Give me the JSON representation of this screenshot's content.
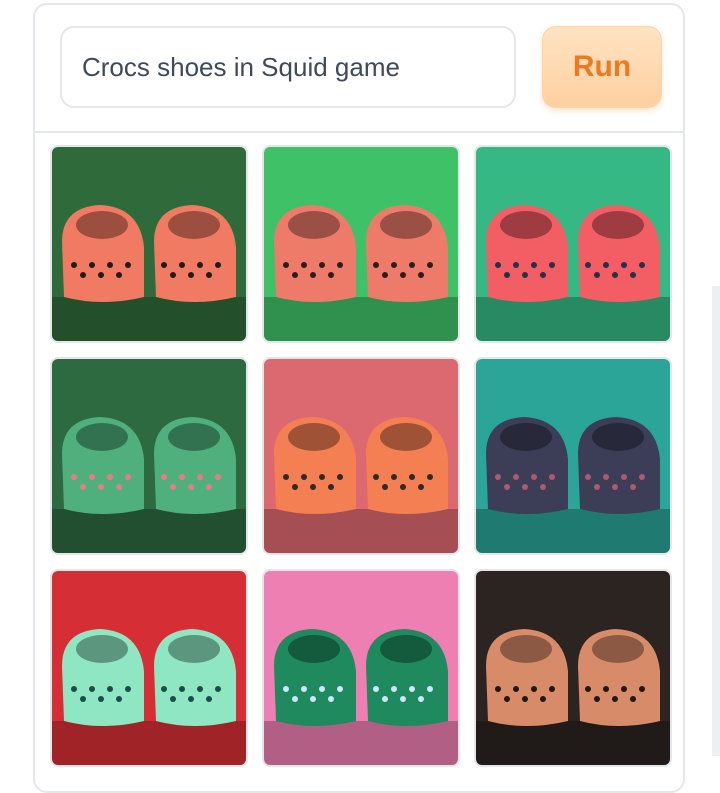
{
  "prompt": {
    "value": "Crocs shoes in Squid game",
    "placeholder": ""
  },
  "run_button": {
    "label": "Run"
  },
  "results": [
    {
      "name": "Coral crocs on green ground",
      "bg": "#2f6b3a",
      "shoe": "#f07a62",
      "accent": "#1d1d1d"
    },
    {
      "name": "Coral crocs on green tile floor",
      "bg": "#3fc267",
      "shoe": "#ee7b6a",
      "accent": "#2a1f1f"
    },
    {
      "name": "Red crocs with charms",
      "bg": "#35b884",
      "shoe": "#f35d64",
      "accent": "#24324d"
    },
    {
      "name": "Green crocs with pink pants",
      "bg": "#2d6a40",
      "shoe": "#4fb07d",
      "accent": "#e87c86"
    },
    {
      "name": "Orange crocs on pink surface",
      "bg": "#dd6970",
      "shoe": "#f47f52",
      "accent": "#2b2b2b"
    },
    {
      "name": "Dark navy crocs",
      "bg": "#2aa597",
      "shoe": "#3c3e58",
      "accent": "#b0596a"
    },
    {
      "name": "Mint crocs on red background",
      "bg": "#d52f35",
      "shoe": "#8ee6c2",
      "accent": "#1d4b4b"
    },
    {
      "name": "Green crocs on pink tiles",
      "bg": "#ee7fb3",
      "shoe": "#1f8a5e",
      "accent": "#d0e3ff"
    },
    {
      "name": "Tan crocs on dark background",
      "bg": "#2b2421",
      "shoe": "#d88b69",
      "accent": "#201612"
    }
  ]
}
